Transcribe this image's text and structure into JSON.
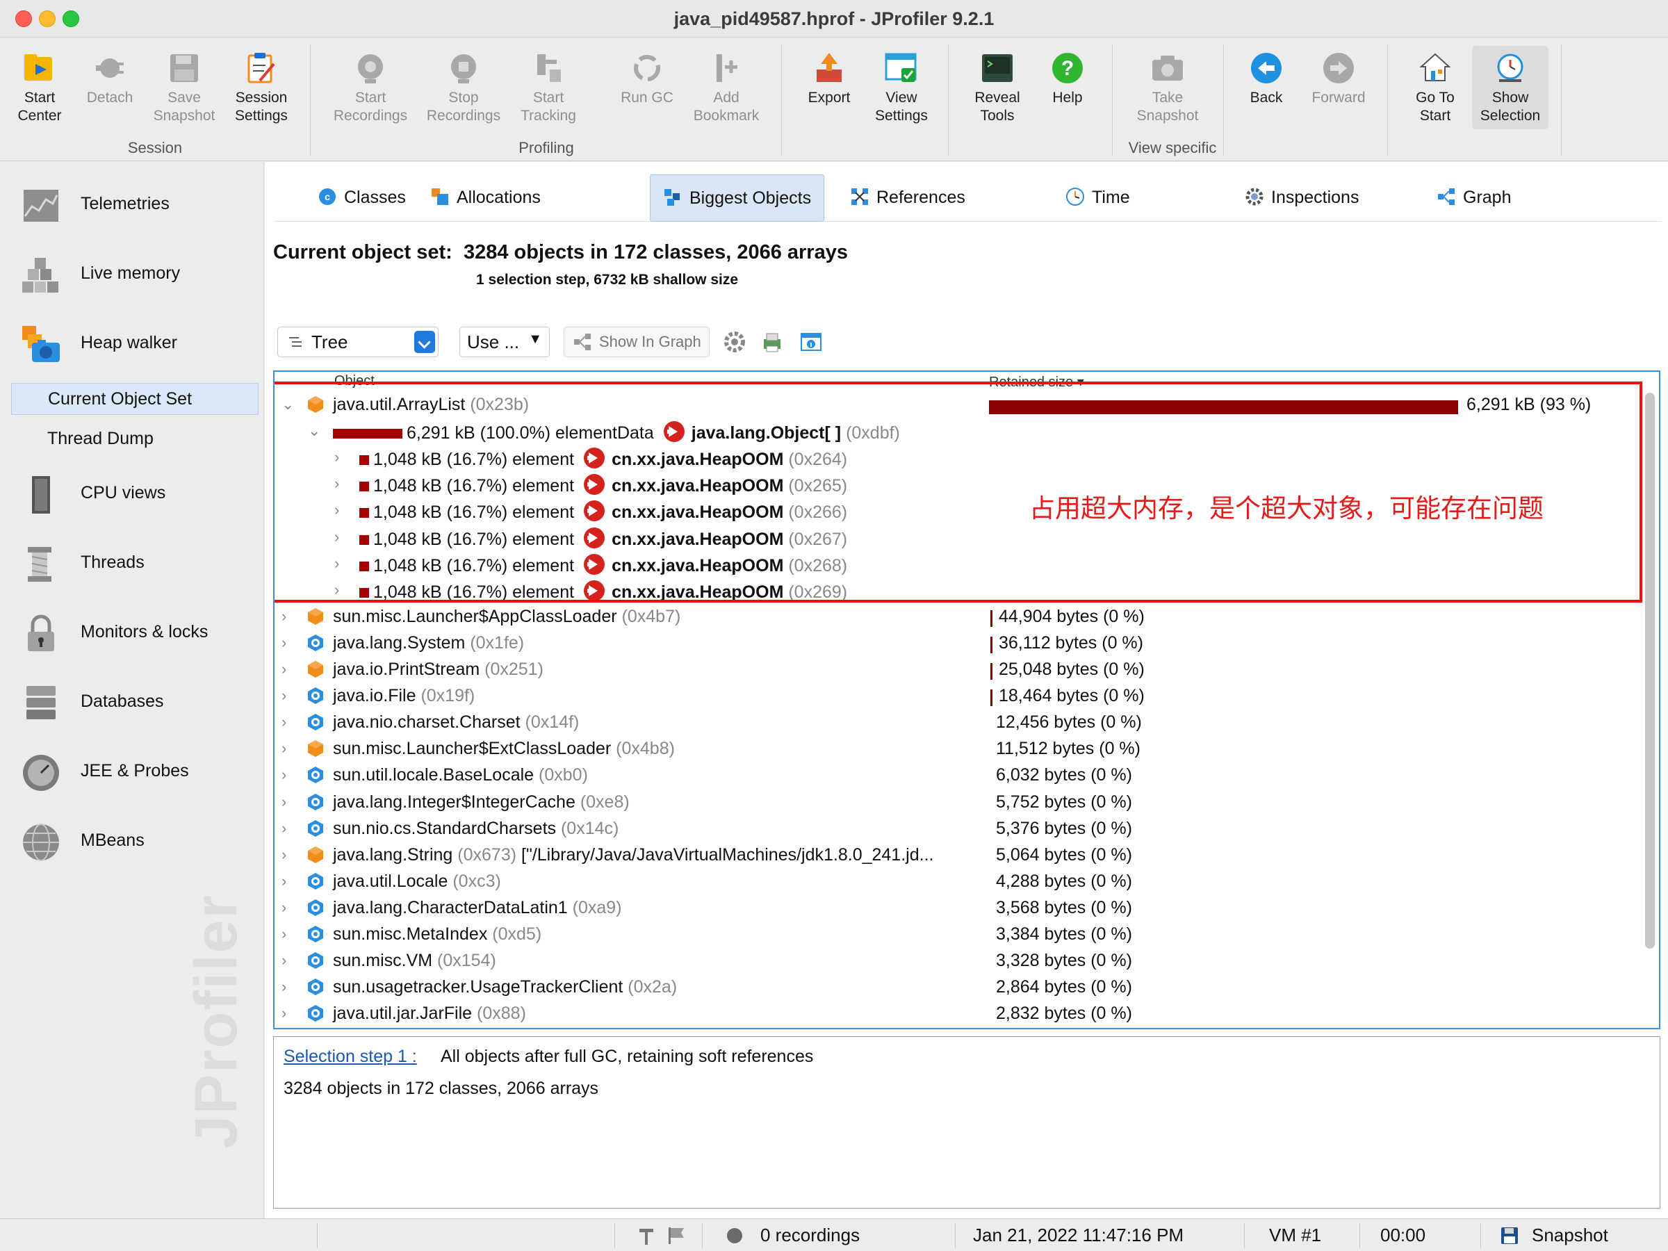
{
  "window": {
    "title": "java_pid49587.hprof - JProfiler 9.2.1"
  },
  "toolbar": {
    "buttons": [
      {
        "id": "start-center",
        "label": "Start\nCenter"
      },
      {
        "id": "detach",
        "label": "Detach"
      },
      {
        "id": "save-snapshot",
        "label": "Save\nSnapshot"
      },
      {
        "id": "session-settings",
        "label": "Session\nSettings"
      },
      {
        "id": "start-recordings",
        "label": "Start\nRecordings"
      },
      {
        "id": "stop-recordings",
        "label": "Stop\nRecordings"
      },
      {
        "id": "start-tracking",
        "label": "Start\nTracking"
      },
      {
        "id": "run-gc",
        "label": "Run GC"
      },
      {
        "id": "add-bookmark",
        "label": "Add\nBookmark"
      },
      {
        "id": "export",
        "label": "Export"
      },
      {
        "id": "view-settings",
        "label": "View\nSettings"
      },
      {
        "id": "reveal-tools",
        "label": "Reveal\nTools"
      },
      {
        "id": "help",
        "label": "Help"
      },
      {
        "id": "take-snapshot",
        "label": "Take\nSnapshot"
      },
      {
        "id": "back",
        "label": "Back"
      },
      {
        "id": "forward",
        "label": "Forward"
      },
      {
        "id": "go-to-start",
        "label": "Go To\nStart"
      },
      {
        "id": "show-selection",
        "label": "Show\nSelection"
      }
    ],
    "groups": [
      "Session",
      "Profiling",
      "View specific"
    ]
  },
  "sidebar": {
    "items": [
      {
        "label": "Telemetries"
      },
      {
        "label": "Live memory"
      },
      {
        "label": "Heap walker"
      },
      {
        "label": "CPU views"
      },
      {
        "label": "Threads"
      },
      {
        "label": "Monitors & locks"
      },
      {
        "label": "Databases"
      },
      {
        "label": "JEE & Probes"
      },
      {
        "label": "MBeans"
      }
    ],
    "subitems": [
      {
        "label": "Current Object Set"
      },
      {
        "label": "Thread Dump"
      }
    ],
    "watermark": "JProfiler"
  },
  "tabs": [
    {
      "label": "Classes"
    },
    {
      "label": "Allocations"
    },
    {
      "label": "Biggest Objects"
    },
    {
      "label": "References"
    },
    {
      "label": "Time"
    },
    {
      "label": "Inspections"
    },
    {
      "label": "Graph"
    }
  ],
  "header": {
    "label": "Current object set:",
    "value": "3284 objects in 172 classes, 2066 arrays",
    "sub": "1 selection step, 6732 kB shallow size"
  },
  "tree_toolbar": {
    "view_mode": "Tree",
    "use": "Use ...",
    "show_in_graph": "Show In Graph"
  },
  "columns": {
    "object": "Object",
    "retained": "Retained size ▾"
  },
  "rows": [
    {
      "name": "java.util.ArrayList",
      "addr": "(0x23b)",
      "retained": "6,291 kB (93 %)",
      "fraction": 0.93,
      "icon": "orange"
    },
    {
      "name": "6,291 kB (100.0%) elementData",
      "target": "java.lang.Object[ ]",
      "addr": "(0xdbf)"
    },
    {
      "name": "1,048 kB (16.7%) element",
      "target": "cn.xx.java.HeapOOM",
      "addr": "(0x264)"
    },
    {
      "name": "1,048 kB (16.7%) element",
      "target": "cn.xx.java.HeapOOM",
      "addr": "(0x265)"
    },
    {
      "name": "1,048 kB (16.7%) element",
      "target": "cn.xx.java.HeapOOM",
      "addr": "(0x266)"
    },
    {
      "name": "1,048 kB (16.7%) element",
      "target": "cn.xx.java.HeapOOM",
      "addr": "(0x267)"
    },
    {
      "name": "1,048 kB (16.7%) element",
      "target": "cn.xx.java.HeapOOM",
      "addr": "(0x268)"
    },
    {
      "name": "1,048 kB (16.7%) element",
      "target": "cn.xx.java.HeapOOM",
      "addr": "(0x269)"
    },
    {
      "name": "sun.misc.Launcher$AppClassLoader",
      "addr": "(0x4b7)",
      "retained": "44,904 bytes (0 %)",
      "icon": "orange",
      "tick": true
    },
    {
      "name": "java.lang.System",
      "addr": "(0x1fe)",
      "retained": "36,112 bytes (0 %)",
      "icon": "blue",
      "tick": true
    },
    {
      "name": "java.io.PrintStream",
      "addr": "(0x251)",
      "retained": "25,048 bytes (0 %)",
      "icon": "orange",
      "tick": true
    },
    {
      "name": "java.io.File",
      "addr": "(0x19f)",
      "retained": "18,464 bytes (0 %)",
      "icon": "blue",
      "tick": true
    },
    {
      "name": "java.nio.charset.Charset",
      "addr": "(0x14f)",
      "retained": "12,456 bytes (0 %)",
      "icon": "blue"
    },
    {
      "name": "sun.misc.Launcher$ExtClassLoader",
      "addr": "(0x4b8)",
      "retained": "11,512 bytes (0 %)",
      "icon": "orange"
    },
    {
      "name": "sun.util.locale.BaseLocale",
      "addr": "(0xb0)",
      "retained": "6,032 bytes (0 %)",
      "icon": "blue"
    },
    {
      "name": "java.lang.Integer$IntegerCache",
      "addr": "(0xe8)",
      "retained": "5,752 bytes (0 %)",
      "icon": "blue"
    },
    {
      "name": "sun.nio.cs.StandardCharsets",
      "addr": "(0x14c)",
      "retained": "5,376 bytes (0 %)",
      "icon": "blue"
    },
    {
      "name": "java.lang.String",
      "addr": "(0x673)",
      "extra": "[\"/Library/Java/JavaVirtualMachines/jdk1.8.0_241.jd...",
      "retained": "5,064 bytes (0 %)",
      "icon": "orange"
    },
    {
      "name": "java.util.Locale",
      "addr": "(0xc3)",
      "retained": "4,288 bytes (0 %)",
      "icon": "blue"
    },
    {
      "name": "java.lang.CharacterDataLatin1",
      "addr": "(0xa9)",
      "retained": "3,568 bytes (0 %)",
      "icon": "blue"
    },
    {
      "name": "sun.misc.MetaIndex",
      "addr": "(0xd5)",
      "retained": "3,384 bytes (0 %)",
      "icon": "blue"
    },
    {
      "name": "sun.misc.VM",
      "addr": "(0x154)",
      "retained": "3,328 bytes (0 %)",
      "icon": "blue"
    },
    {
      "name": "sun.usagetracker.UsageTrackerClient",
      "addr": "(0x2a)",
      "retained": "2,864 bytes (0 %)",
      "icon": "blue"
    },
    {
      "name": "java.util.jar.JarFile",
      "addr": "(0x88)",
      "retained": "2,832 bytes (0 %)",
      "icon": "blue"
    }
  ],
  "annotation": "占用超大内存，是个超大对象，可能存在问题",
  "detail": {
    "link": "Selection step 1 :",
    "description": "All objects after full GC, retaining soft references",
    "count": "3284 objects in 172 classes, 2066 arrays"
  },
  "status": {
    "recordings": "0 recordings",
    "datetime": "Jan 21, 2022 11:47:16 PM",
    "vm": "VM #1",
    "time": "00:00",
    "mode": "Snapshot"
  },
  "colors": {
    "accent": "#1f7ae0",
    "retained_bar": "#8b0000",
    "highlight": "#ee1111",
    "link": "#1a57b8"
  }
}
